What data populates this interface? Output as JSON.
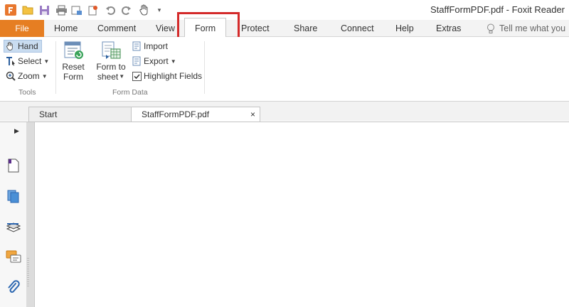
{
  "app": {
    "window_title": "StaffFormPDF.pdf - Foxit Reader"
  },
  "quick_access": {
    "icons": [
      "foxit-logo-icon",
      "open-icon",
      "save-icon",
      "print-icon",
      "email-icon",
      "new-icon",
      "undo-icon",
      "redo-icon",
      "hand-tool-icon",
      "customize-icon"
    ]
  },
  "ribbon_tabs": {
    "file": "File",
    "home": "Home",
    "comment": "Comment",
    "view": "View",
    "form": "Form",
    "protect": "Protect",
    "share": "Share",
    "connect": "Connect",
    "help": "Help",
    "extras": "Extras",
    "active": "Form"
  },
  "tell_me": {
    "placeholder": "Tell me what you"
  },
  "tools_group": {
    "label": "Tools",
    "hand": "Hand",
    "select": "Select",
    "zoom": "Zoom"
  },
  "form_data_group": {
    "label": "Form Data",
    "reset_line1": "Reset",
    "reset_line2": "Form",
    "form_to_line1": "Form to",
    "form_to_line2": "sheet",
    "import": "Import",
    "export": "Export",
    "highlight_fields": "Highlight Fields",
    "highlight_checked": true
  },
  "document_tabs": {
    "start": "Start",
    "current": "StaffFormPDF.pdf",
    "close_glyph": "×"
  },
  "sidebar": {
    "icons": [
      "page-thumbnails-icon",
      "pages-icon",
      "layers-icon",
      "comments-icon",
      "attachments-icon"
    ]
  },
  "colors": {
    "file_tab": "#e67e22",
    "highlight_box": "#d42a2a",
    "hand_active": "#c9dcf0"
  }
}
